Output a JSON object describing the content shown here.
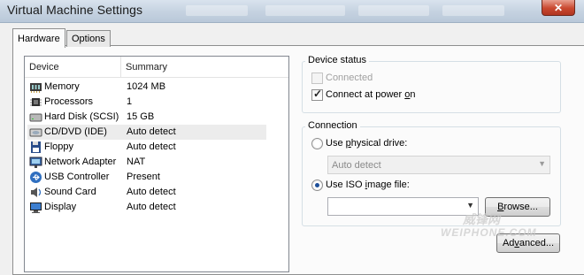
{
  "window": {
    "title": "Virtual Machine Settings",
    "close_symbol": "✕"
  },
  "tabs": [
    {
      "label": "Hardware",
      "active": true
    },
    {
      "label": "Options",
      "active": false
    }
  ],
  "device_list": {
    "columns": [
      "Device",
      "Summary"
    ],
    "rows": [
      {
        "device": "Memory",
        "summary": "1024 MB",
        "icon": "memory-icon"
      },
      {
        "device": "Processors",
        "summary": "1",
        "icon": "processor-icon"
      },
      {
        "device": "Hard Disk (SCSI)",
        "summary": "15 GB",
        "icon": "hard-disk-icon"
      },
      {
        "device": "CD/DVD (IDE)",
        "summary": "Auto detect",
        "icon": "cd-dvd-icon",
        "selected": true
      },
      {
        "device": "Floppy",
        "summary": "Auto detect",
        "icon": "floppy-icon"
      },
      {
        "device": "Network Adapter",
        "summary": "NAT",
        "icon": "network-icon"
      },
      {
        "device": "USB Controller",
        "summary": "Present",
        "icon": "usb-icon"
      },
      {
        "device": "Sound Card",
        "summary": "Auto detect",
        "icon": "sound-icon"
      },
      {
        "device": "Display",
        "summary": "Auto detect",
        "icon": "display-icon"
      }
    ]
  },
  "device_status": {
    "group_label": "Device status",
    "connected_label": "Connected",
    "connected_checked": false,
    "connected_disabled": true,
    "connect_power_label_pre": "Connect at power ",
    "connect_power_label_u": "o",
    "connect_power_label_post": "n",
    "connect_power_checked": true
  },
  "connection": {
    "group_label": "Connection",
    "physical_pre": "Use ",
    "physical_u": "p",
    "physical_post": "hysical drive:",
    "physical_selected": false,
    "physical_value": "Auto detect",
    "iso_pre": "Use ISO ",
    "iso_u": "i",
    "iso_post": "mage file:",
    "iso_selected": true,
    "iso_value": "",
    "browse_pre": "",
    "browse_u": "B",
    "browse_post": "rowse...",
    "advanced_pre": "Ad",
    "advanced_u": "v",
    "advanced_post": "anced..."
  },
  "watermark": {
    "text_top": "威锋网",
    "text_bottom": "WEIPHONE.COM"
  },
  "colors": {
    "selected_row": "#ececec",
    "radio_dot": "#1d4f9a"
  }
}
